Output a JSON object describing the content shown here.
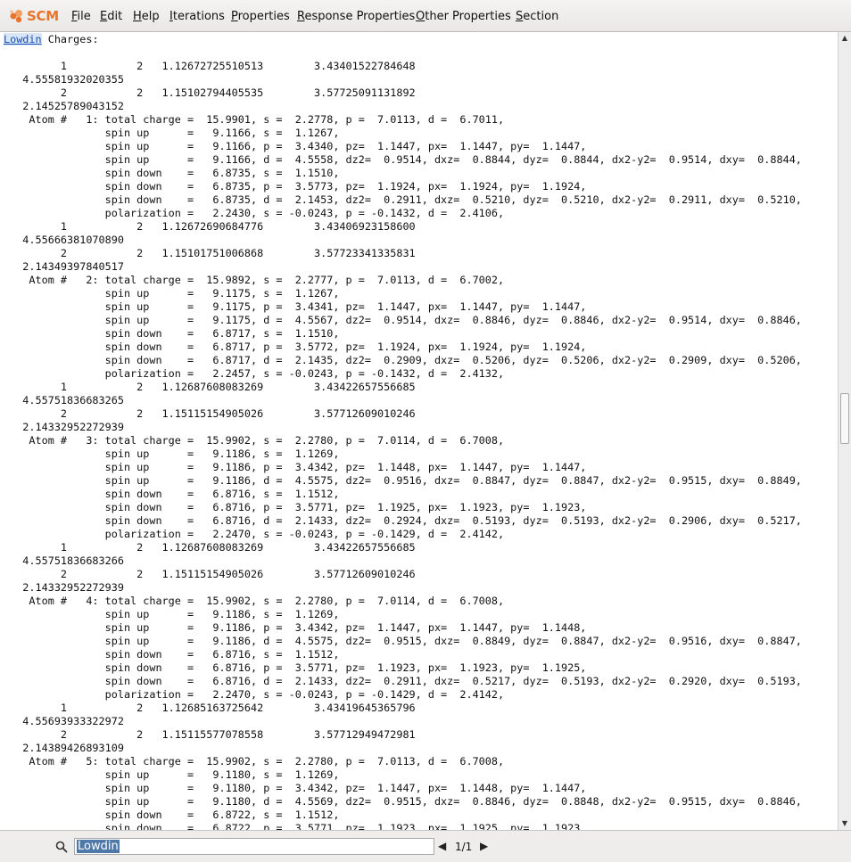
{
  "app": {
    "logo_text": "SCM"
  },
  "menu": [
    {
      "pre": "",
      "u": "F",
      "post": "ile"
    },
    {
      "pre": "",
      "u": "E",
      "post": "dit"
    },
    {
      "pre": "",
      "u": "H",
      "post": "elp"
    },
    {
      "pre": "",
      "u": "I",
      "post": "terations"
    },
    {
      "pre": "",
      "u": "P",
      "post": "roperties"
    },
    {
      "pre": "",
      "u": "R",
      "post": "esponse Properties"
    },
    {
      "pre": "",
      "u": "O",
      "post": "ther Properties"
    },
    {
      "pre": "",
      "u": "S",
      "post": "ection"
    }
  ],
  "output": {
    "highlight": "Lowdin",
    "first_line_rest": " Charges:",
    "lines": [
      "",
      "         1           2   1.12672725510513        3.43401522784648",
      "   4.55581932020355",
      "         2           2   1.15102794405535        3.57725091131892",
      "   2.14525789043152",
      "    Atom #   1: total charge =  15.9901, s =  2.2778, p =  7.0113, d =  6.7011,",
      "                spin up      =   9.1166, s =  1.1267,",
      "                spin up      =   9.1166, p =  3.4340, pz=  1.1447, px=  1.1447, py=  1.1447,",
      "                spin up      =   9.1166, d =  4.5558, dz2=  0.9514, dxz=  0.8844, dyz=  0.8844, dx2-y2=  0.9514, dxy=  0.8844,",
      "                spin down    =   6.8735, s =  1.1510,",
      "                spin down    =   6.8735, p =  3.5773, pz=  1.1924, px=  1.1924, py=  1.1924,",
      "                spin down    =   6.8735, d =  2.1453, dz2=  0.2911, dxz=  0.5210, dyz=  0.5210, dx2-y2=  0.2911, dxy=  0.5210,",
      "                polarization =   2.2430, s = -0.0243, p = -0.1432, d =  2.4106,",
      "         1           2   1.12672690684776        3.43406923158600",
      "   4.55666381070890",
      "         2           2   1.15101751006868        3.57723341335831",
      "   2.14349397840517",
      "    Atom #   2: total charge =  15.9892, s =  2.2777, p =  7.0113, d =  6.7002,",
      "                spin up      =   9.1175, s =  1.1267,",
      "                spin up      =   9.1175, p =  3.4341, pz=  1.1447, px=  1.1447, py=  1.1447,",
      "                spin up      =   9.1175, d =  4.5567, dz2=  0.9514, dxz=  0.8846, dyz=  0.8846, dx2-y2=  0.9514, dxy=  0.8846,",
      "                spin down    =   6.8717, s =  1.1510,",
      "                spin down    =   6.8717, p =  3.5772, pz=  1.1924, px=  1.1924, py=  1.1924,",
      "                spin down    =   6.8717, d =  2.1435, dz2=  0.2909, dxz=  0.5206, dyz=  0.5206, dx2-y2=  0.2909, dxy=  0.5206,",
      "                polarization =   2.2457, s = -0.0243, p = -0.1432, d =  2.4132,",
      "         1           2   1.12687608083269        3.43422657556685",
      "   4.55751836683265",
      "         2           2   1.15115154905026        3.57712609010246",
      "   2.14332952272939",
      "    Atom #   3: total charge =  15.9902, s =  2.2780, p =  7.0114, d =  6.7008,",
      "                spin up      =   9.1186, s =  1.1269,",
      "                spin up      =   9.1186, p =  3.4342, pz=  1.1448, px=  1.1447, py=  1.1447,",
      "                spin up      =   9.1186, d =  4.5575, dz2=  0.9516, dxz=  0.8847, dyz=  0.8847, dx2-y2=  0.9515, dxy=  0.8849,",
      "                spin down    =   6.8716, s =  1.1512,",
      "                spin down    =   6.8716, p =  3.5771, pz=  1.1925, px=  1.1923, py=  1.1923,",
      "                spin down    =   6.8716, d =  2.1433, dz2=  0.2924, dxz=  0.5193, dyz=  0.5193, dx2-y2=  0.2906, dxy=  0.5217,",
      "                polarization =   2.2470, s = -0.0243, p = -0.1429, d =  2.4142,",
      "         1           2   1.12687608083269        3.43422657556685",
      "   4.55751836683266",
      "         2           2   1.15115154905026        3.57712609010246",
      "   2.14332952272939",
      "    Atom #   4: total charge =  15.9902, s =  2.2780, p =  7.0114, d =  6.7008,",
      "                spin up      =   9.1186, s =  1.1269,",
      "                spin up      =   9.1186, p =  3.4342, pz=  1.1447, px=  1.1447, py=  1.1448,",
      "                spin up      =   9.1186, d =  4.5575, dz2=  0.9515, dxz=  0.8849, dyz=  0.8847, dx2-y2=  0.9516, dxy=  0.8847,",
      "                spin down    =   6.8716, s =  1.1512,",
      "                spin down    =   6.8716, p =  3.5771, pz=  1.1923, px=  1.1923, py=  1.1925,",
      "                spin down    =   6.8716, d =  2.1433, dz2=  0.2911, dxz=  0.5217, dyz=  0.5193, dx2-y2=  0.2920, dxy=  0.5193,",
      "                polarization =   2.2470, s = -0.0243, p = -0.1429, d =  2.4142,",
      "         1           2   1.12685163725642        3.43419645365796",
      "   4.55693933322972",
      "         2           2   1.15115577078558        3.57712949472981",
      "   2.14389426893109",
      "    Atom #   5: total charge =  15.9902, s =  2.2780, p =  7.0113, d =  6.7008,",
      "                spin up      =   9.1180, s =  1.1269,",
      "                spin up      =   9.1180, p =  3.4342, pz=  1.1447, px=  1.1448, py=  1.1447,",
      "                spin up      =   9.1180, d =  4.5569, dz2=  0.9515, dxz=  0.8846, dyz=  0.8848, dx2-y2=  0.9515, dxy=  0.8846,",
      "                spin down    =   6.8722, s =  1.1512,",
      "                spin down    =   6.8722, p =  3.5771, pz=  1.1923, px=  1.1925, py=  1.1923,"
    ]
  },
  "find": {
    "query": "Lowdin",
    "counter": "1/1"
  }
}
